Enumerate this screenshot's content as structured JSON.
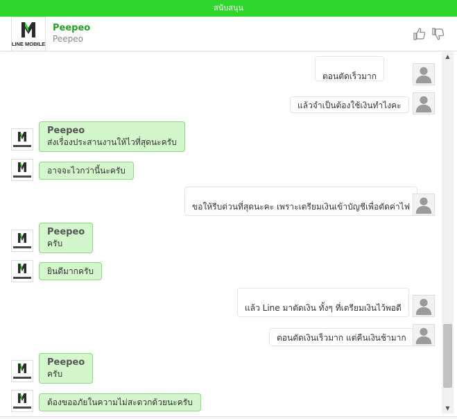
{
  "topbar": {
    "label": "สนับสนุน"
  },
  "header": {
    "name": "Peepeo",
    "subtitle": "Peepeo",
    "logo_text": "LINE MOBILE",
    "like_icon": "thumbs-up-icon",
    "dislike_icon": "thumbs-down-icon"
  },
  "colors": {
    "accent": "#2fd62b",
    "bot_bubble": "#d3f6cd",
    "bot_border": "#8cd882",
    "name_green": "#25a025"
  },
  "messages": [
    {
      "from": "user",
      "text": "ตอนตัดเร็วมาก"
    },
    {
      "from": "user",
      "text": "แล้วจำเป็นต้องใช้เงินทำไงคะ"
    },
    {
      "from": "bot",
      "name": "Peepeo",
      "text": "ส่งเรื่องประสานงานให้ไวที่สุดนะครับ"
    },
    {
      "from": "bot",
      "text": "อาจจะไวกว่านี้นะครับ"
    },
    {
      "from": "user",
      "text": "ขอให้รีบด่วนที่สุดนะคะ เพราะเตรียมเงินเข้าบัญชีเพื่อตัดค่าไฟ"
    },
    {
      "from": "bot",
      "name": "Peepeo",
      "text": "ครับ"
    },
    {
      "from": "bot",
      "text": "ยินดีมากครับ"
    },
    {
      "from": "user",
      "text": "แล้ว Line มาตัดเงิน ทั้งๆ ที่เตรียมเงินไว้พอดี"
    },
    {
      "from": "user",
      "text": "ตอนตัดเงินเร็วมาก แต่คืนเงินช้ามาก"
    },
    {
      "from": "bot",
      "name": "Peepeo",
      "text": "ครับ"
    },
    {
      "from": "bot",
      "text": "ต้องขออภัยในความไม่สะดวกด้วยนะครับ"
    }
  ]
}
